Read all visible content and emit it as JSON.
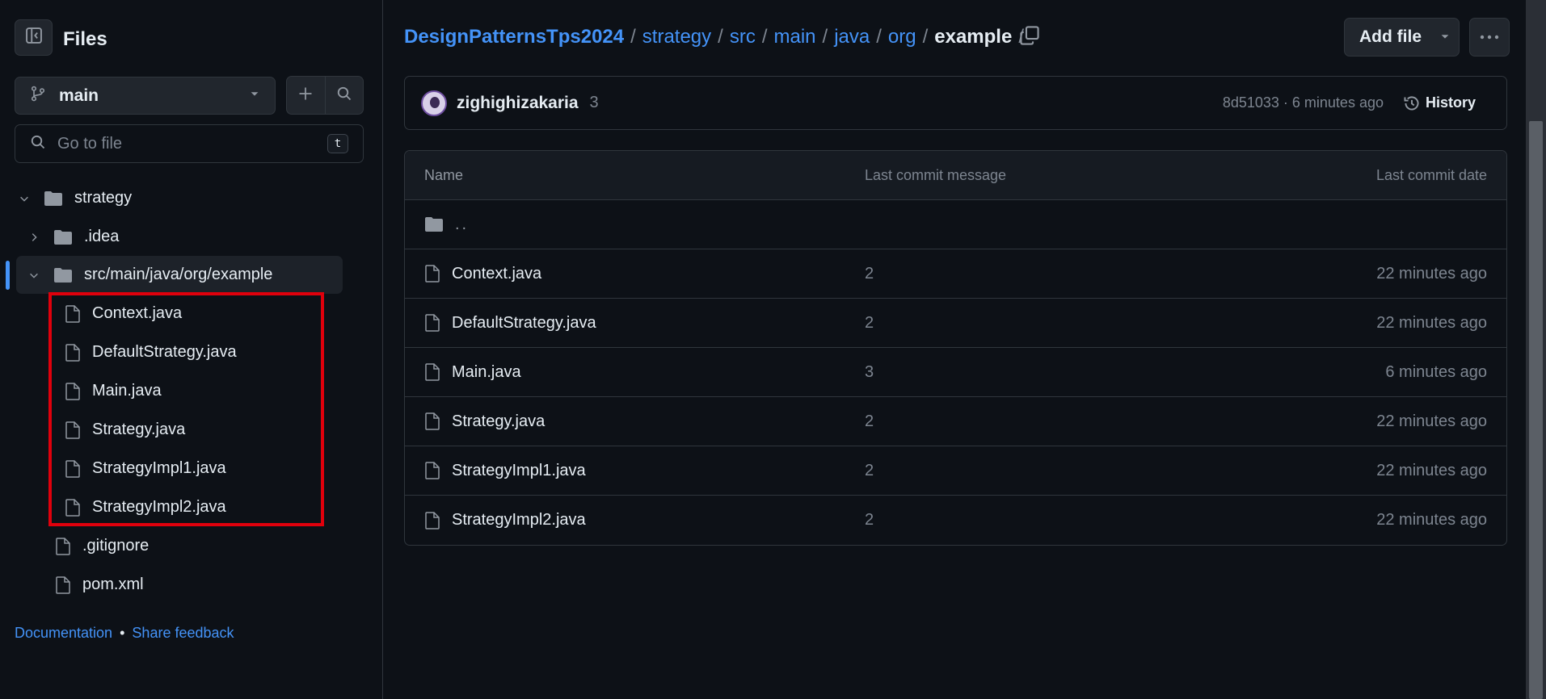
{
  "sidebar": {
    "title": "Files",
    "branch": "main",
    "search_placeholder": "Go to file",
    "search_shortcut": "t",
    "tree": [
      {
        "label": "strategy"
      },
      {
        "label": ".idea"
      },
      {
        "label": "src/main/java/org/example"
      },
      {
        "label": "Context.java"
      },
      {
        "label": "DefaultStrategy.java"
      },
      {
        "label": "Main.java"
      },
      {
        "label": "Strategy.java"
      },
      {
        "label": "StrategyImpl1.java"
      },
      {
        "label": "StrategyImpl2.java"
      },
      {
        "label": ".gitignore"
      },
      {
        "label": "pom.xml"
      }
    ],
    "footer": {
      "documentation": "Documentation",
      "separator": "•",
      "feedback": "Share feedback"
    }
  },
  "breadcrumb": {
    "repo": "DesignPatternsTps2024",
    "parts": [
      "strategy",
      "src",
      "main",
      "java",
      "org"
    ],
    "current": "example",
    "separator": "/"
  },
  "toolbar": {
    "add_file": "Add file"
  },
  "commit": {
    "author": "zighighizakaria",
    "count": "3",
    "meta": "8d51033 · 6 minutes ago",
    "history": "History"
  },
  "table": {
    "headers": {
      "name": "Name",
      "message": "Last commit message",
      "date": "Last commit date"
    },
    "parent": "..",
    "rows": [
      {
        "name": "Context.java",
        "message": "2",
        "date": "22 minutes ago"
      },
      {
        "name": "DefaultStrategy.java",
        "message": "2",
        "date": "22 minutes ago"
      },
      {
        "name": "Main.java",
        "message": "3",
        "date": "6 minutes ago"
      },
      {
        "name": "Strategy.java",
        "message": "2",
        "date": "22 minutes ago"
      },
      {
        "name": "StrategyImpl1.java",
        "message": "2",
        "date": "22 minutes ago"
      },
      {
        "name": "StrategyImpl2.java",
        "message": "2",
        "date": "22 minutes ago"
      }
    ]
  },
  "colors": {
    "accent": "#4493f8",
    "highlight": "#e0000c",
    "background": "#0d1117"
  }
}
